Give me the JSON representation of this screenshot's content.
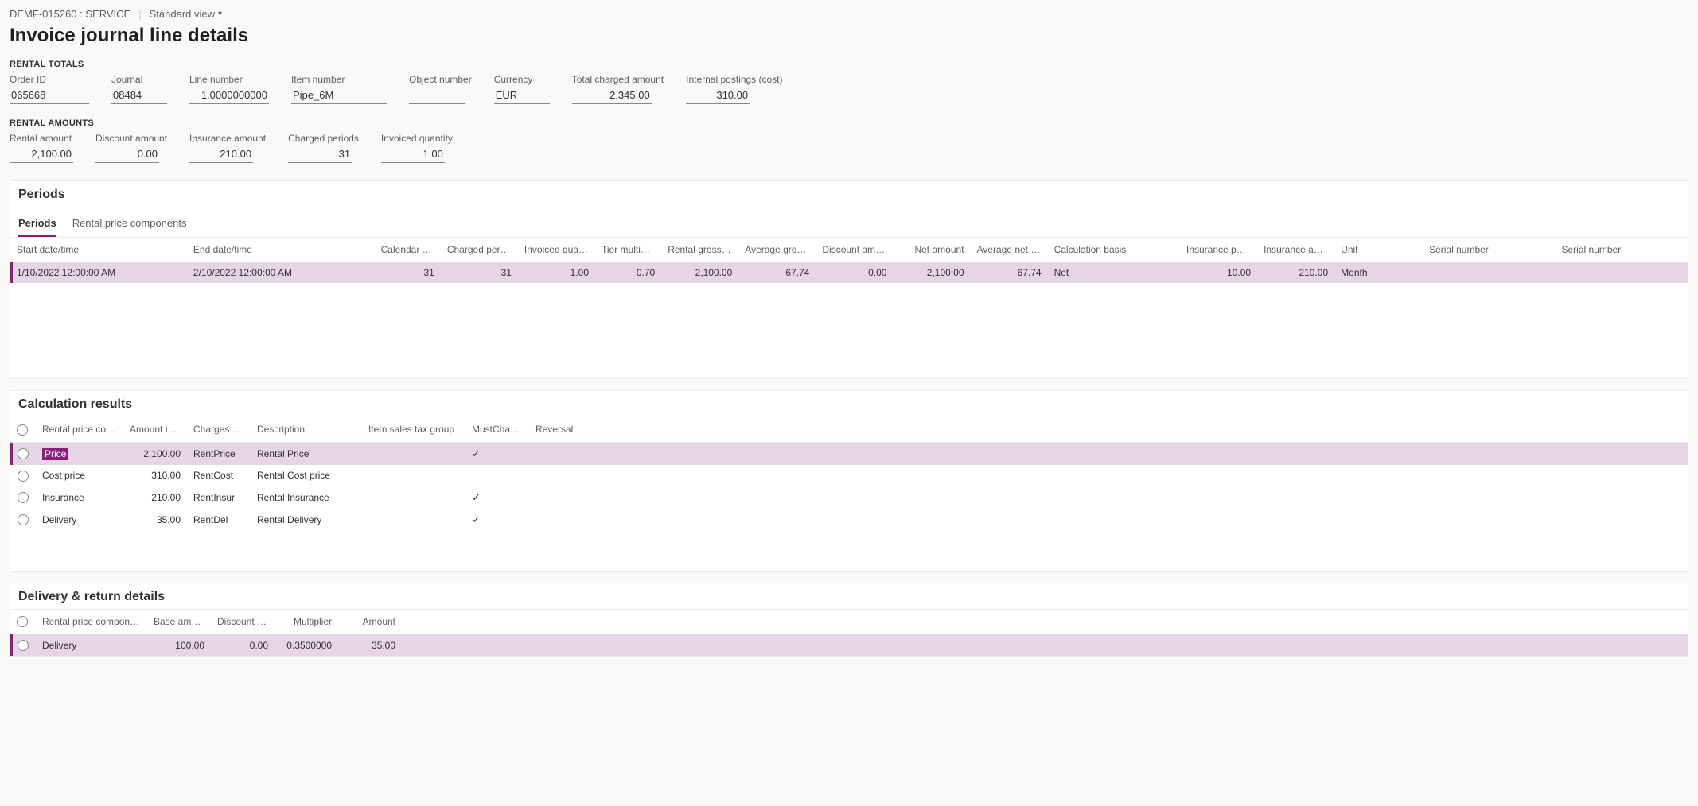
{
  "breadcrumb": {
    "entity": "DEMF-015260 : SERVICE",
    "view_label": "Standard view"
  },
  "page_title": "Invoice journal line details",
  "rental_totals": {
    "heading": "RENTAL TOTALS",
    "fields": {
      "order_id": {
        "label": "Order ID",
        "value": "065668"
      },
      "journal": {
        "label": "Journal",
        "value": "08484"
      },
      "line_number": {
        "label": "Line number",
        "value": "1.0000000000"
      },
      "item_number": {
        "label": "Item number",
        "value": "Pipe_6M"
      },
      "object_number": {
        "label": "Object number",
        "value": ""
      },
      "currency": {
        "label": "Currency",
        "value": "EUR"
      },
      "total_charged": {
        "label": "Total charged amount",
        "value": "2,345.00"
      },
      "internal_postings": {
        "label": "Internal postings (cost)",
        "value": "310.00"
      }
    }
  },
  "rental_amounts": {
    "heading": "RENTAL AMOUNTS",
    "fields": {
      "rental_amount": {
        "label": "Rental amount",
        "value": "2,100.00"
      },
      "discount_amount": {
        "label": "Discount amount",
        "value": "0.00"
      },
      "insurance_amount": {
        "label": "Insurance amount",
        "value": "210.00"
      },
      "charged_periods": {
        "label": "Charged periods",
        "value": "31"
      },
      "invoiced_quantity": {
        "label": "Invoiced quantity",
        "value": "1.00"
      }
    }
  },
  "periods_panel": {
    "title": "Periods",
    "tabs": {
      "periods": "Periods",
      "rpc": "Rental price components"
    },
    "headers": {
      "start": "Start date/time",
      "end": "End date/time",
      "calendar_days": "Calendar days",
      "charged_periods": "Charged periods",
      "invoiced_qty": "Invoiced quant…",
      "tier_mult": "Tier multiplier",
      "rental_gross": "Rental gross a…",
      "avg_gross": "Average gross …",
      "discount_amt": "Discount amo…",
      "net_amount": "Net amount",
      "avg_net": "Average net pr…",
      "calc_basis": "Calculation basis",
      "ins_perc": "Insurance perc…",
      "ins_amt": "Insurance amo…",
      "unit": "Unit",
      "serial1": "Serial number",
      "serial2": "Serial number"
    },
    "row": {
      "start": "1/10/2022 12:00:00 AM",
      "end": "2/10/2022 12:00:00 AM",
      "calendar_days": "31",
      "charged_periods": "31",
      "invoiced_qty": "1.00",
      "tier_mult": "0.70",
      "rental_gross": "2,100.00",
      "avg_gross": "67.74",
      "discount_amt": "0.00",
      "net_amount": "2,100.00",
      "avg_net": "67.74",
      "calc_basis": "Net",
      "ins_perc": "10.00",
      "ins_amt": "210.00",
      "unit": "Month",
      "serial1": "",
      "serial2": ""
    }
  },
  "calc_results": {
    "title": "Calculation results",
    "headers": {
      "component": "Rental price compone…",
      "amount_tr": "Amount in tra…",
      "charges_code": "Charges code",
      "description": "Description",
      "item_tax": "Item sales tax group",
      "must_charge": "MustCharge",
      "reversal": "Reversal"
    },
    "rows": [
      {
        "component": "Price",
        "amount": "2,100.00",
        "code": "RentPrice",
        "desc": "Rental Price",
        "tax": "",
        "must_charge": true,
        "reversal": "",
        "selected": true
      },
      {
        "component": "Cost price",
        "amount": "310.00",
        "code": "RentCost",
        "desc": "Rental Cost price",
        "tax": "",
        "must_charge": false,
        "reversal": "",
        "selected": false
      },
      {
        "component": "Insurance",
        "amount": "210.00",
        "code": "RentInsur",
        "desc": "Rental Insurance",
        "tax": "",
        "must_charge": true,
        "reversal": "",
        "selected": false
      },
      {
        "component": "Delivery",
        "amount": "35.00",
        "code": "RentDel",
        "desc": "Rental Delivery",
        "tax": "",
        "must_charge": true,
        "reversal": "",
        "selected": false
      }
    ]
  },
  "delivery_return": {
    "title": "Delivery & return details",
    "headers": {
      "component": "Rental price components",
      "base": "Base amount",
      "discount": "Discount amo…",
      "multiplier": "Multiplier",
      "amount": "Amount"
    },
    "row": {
      "component": "Delivery",
      "base": "100.00",
      "discount": "0.00",
      "multiplier": "0.3500000",
      "amount": "35.00"
    }
  }
}
